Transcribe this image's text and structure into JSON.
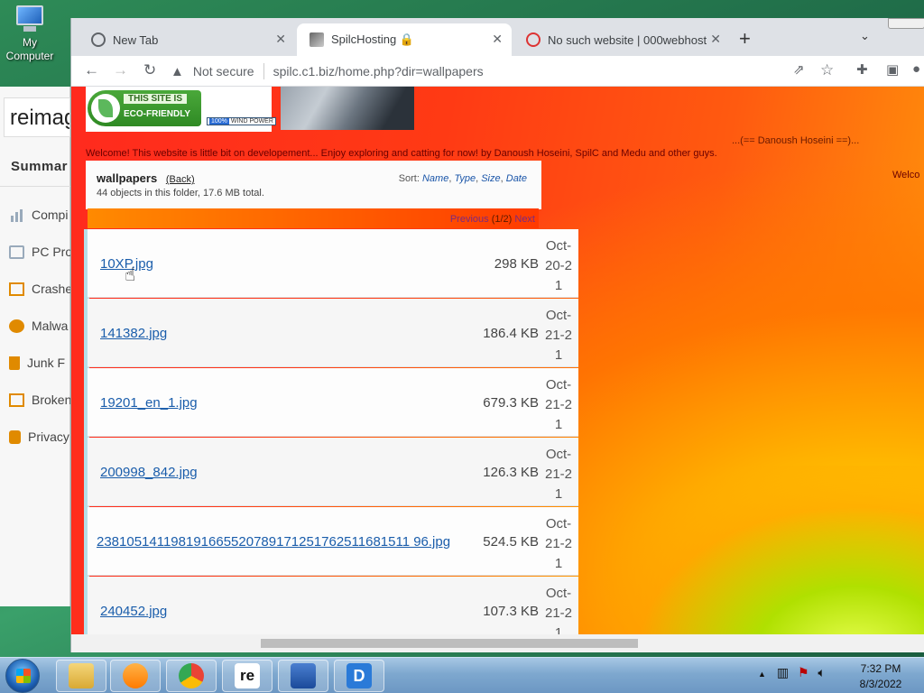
{
  "desktop": {
    "icon_label_line1": "My",
    "icon_label_line2": "Computer"
  },
  "reimage": {
    "logo": "reimag",
    "summary": "Summar",
    "items": [
      {
        "label": "Compi",
        "icon": "chart-icon"
      },
      {
        "label": "PC Pro",
        "icon": "monitor-icon"
      },
      {
        "label": "Crashe",
        "icon": "crash-icon"
      },
      {
        "label": "Malwa",
        "icon": "bug-icon"
      },
      {
        "label": "Junk F",
        "icon": "trash-icon"
      },
      {
        "label": "Broken",
        "icon": "broken-icon"
      },
      {
        "label": "Privacy",
        "icon": "lock-icon"
      }
    ]
  },
  "browser": {
    "tabs": [
      {
        "label": "New Tab",
        "close": "✕"
      },
      {
        "label": "SpilcHosting 🔒",
        "close": "✕"
      },
      {
        "label": "No such website | 000webhost",
        "close": "✕"
      }
    ],
    "new_tab": "+",
    "tab_menu": "⌄",
    "security_label": "Not secure",
    "url": "spilc.c1.biz/home.php?dir=wallpapers"
  },
  "page": {
    "eco_line1": "THIS SITE IS",
    "eco_line2": "ECO-FRIENDLY",
    "wind_pct": "100%",
    "wind_text": "WIND POWER",
    "signature": "...(== Danoush Hoseini ==)...",
    "welcome": "Welcome! This website is little bit on developement... Enjoy exploring and catting for now! by Danoush Hoseini, SpilC and Medu and other guys.",
    "welcome_right": "Welco",
    "folder_title": "wallpapers",
    "back_label": "(Back)",
    "folder_summary": "44 objects in this folder, 17.6 MB total.",
    "sort_label": "Sort:",
    "sort_options": [
      "Name",
      "Type",
      "Size",
      "Date"
    ],
    "pager_prev": "Previous",
    "pager_page": "(1/2)",
    "pager_next": "Next",
    "files": [
      {
        "name": "10XP.jpg",
        "size": "298 KB",
        "date": "Oct-20-21"
      },
      {
        "name": "141382.jpg",
        "size": "186.4 KB",
        "date": "Oct-21-21"
      },
      {
        "name": "19201_en_1.jpg",
        "size": "679.3 KB",
        "date": "Oct-21-21"
      },
      {
        "name": "200998_842.jpg",
        "size": "126.3 KB",
        "date": "Oct-21-21"
      },
      {
        "name": "238105141198191665520789171251762511681511 96.jpg",
        "size": "524.5 KB",
        "date": "Oct-21-21"
      },
      {
        "name": "240452.jpg",
        "size": "107.3 KB",
        "date": "Oct-21-21"
      }
    ]
  },
  "taskbar": {
    "time": "7:32 PM",
    "date": "8/3/2022",
    "tray_arrow": "▲"
  }
}
